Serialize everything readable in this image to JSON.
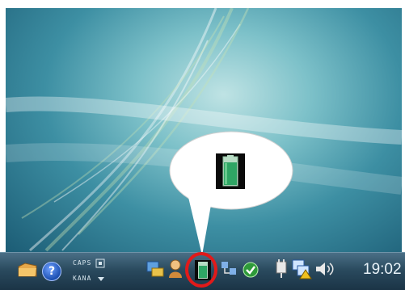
{
  "taskbar": {
    "language_bar": {
      "caps_label": "CAPS",
      "kana_label": "KANA",
      "icon": "language-bar-icon"
    },
    "help_icon_glyph": "?",
    "clock": "19:02",
    "tray_icons": [
      "network-icon",
      "user-icon",
      "battery-meter-icon",
      "network-status-icon",
      "security-icon",
      "power-plug-icon",
      "network-warning-icon",
      "speaker-icon"
    ]
  },
  "callout": {
    "icon": "battery-meter-icon",
    "highlight_color": "#e11a1a"
  },
  "colors": {
    "highlight": "#e11a1a",
    "battery_fill": "#2fa564"
  }
}
